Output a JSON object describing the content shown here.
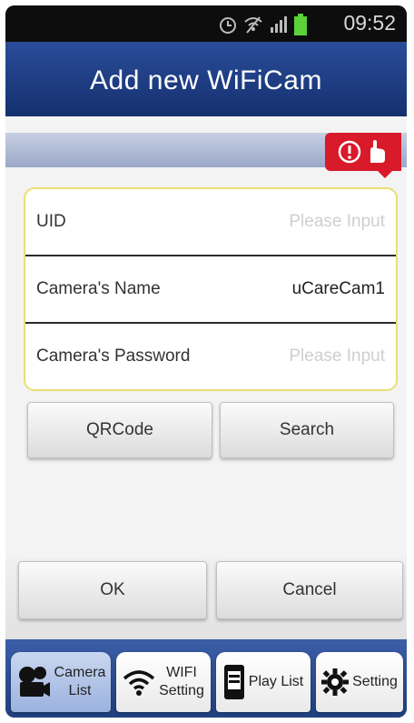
{
  "status": {
    "time": "09:52",
    "icons": [
      "alarm-icon",
      "wifi-off-icon",
      "signal-icon",
      "battery-icon"
    ]
  },
  "header": {
    "title": "Add new WiFiCam"
  },
  "help": {
    "icon": "info-icon",
    "icon2": "hand-icon"
  },
  "form": {
    "uid_label": "UID",
    "uid_placeholder": "Please Input",
    "name_label": "Camera's Name",
    "name_value": "uCareCam1",
    "password_label": "Camera's Password",
    "password_placeholder": "Please Input"
  },
  "buttons": {
    "qrcode": "QRCode",
    "search": "Search",
    "ok": "OK",
    "cancel": "Cancel"
  },
  "tabs": {
    "camera_list_line1": "Camera",
    "camera_list_line2": "List",
    "wifi_line1": "WIFI",
    "wifi_line2": "Setting",
    "playlist": "Play List",
    "setting": "Setting"
  },
  "colors": {
    "titlebar": "#1f3f85",
    "badge": "#d81a2b",
    "form_border": "#e8e070",
    "tabbar": "#2b4d95"
  }
}
